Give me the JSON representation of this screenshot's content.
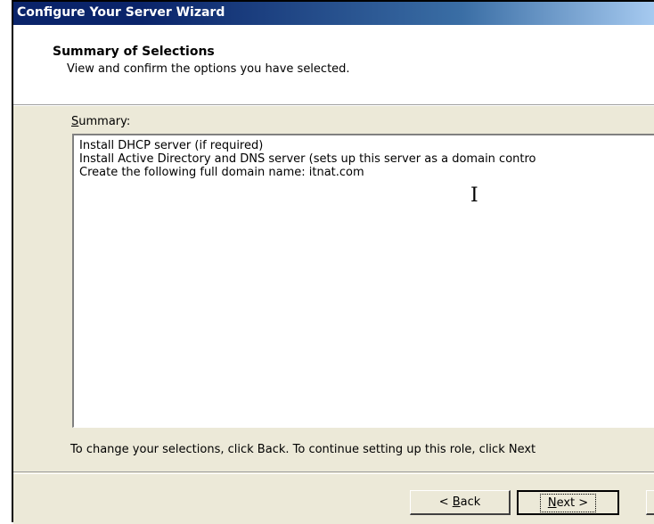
{
  "window": {
    "title": "Configure Your Server Wizard"
  },
  "header": {
    "title": "Summary of Selections",
    "subtitle": "View and confirm the options you have selected."
  },
  "summary": {
    "label_access": "S",
    "label_rest": "ummary:",
    "lines": [
      "Install DHCP server (if required)",
      "Install Active Directory and DNS server (sets up this server as a domain contro",
      "Create the following full domain name: itnat.com"
    ]
  },
  "instructions": "To change your selections, click Back. To continue setting up this role, click Next",
  "buttons": {
    "back_prefix": "< ",
    "back_access": "B",
    "back_rest": "ack",
    "next_access": "N",
    "next_rest": "ext >"
  }
}
